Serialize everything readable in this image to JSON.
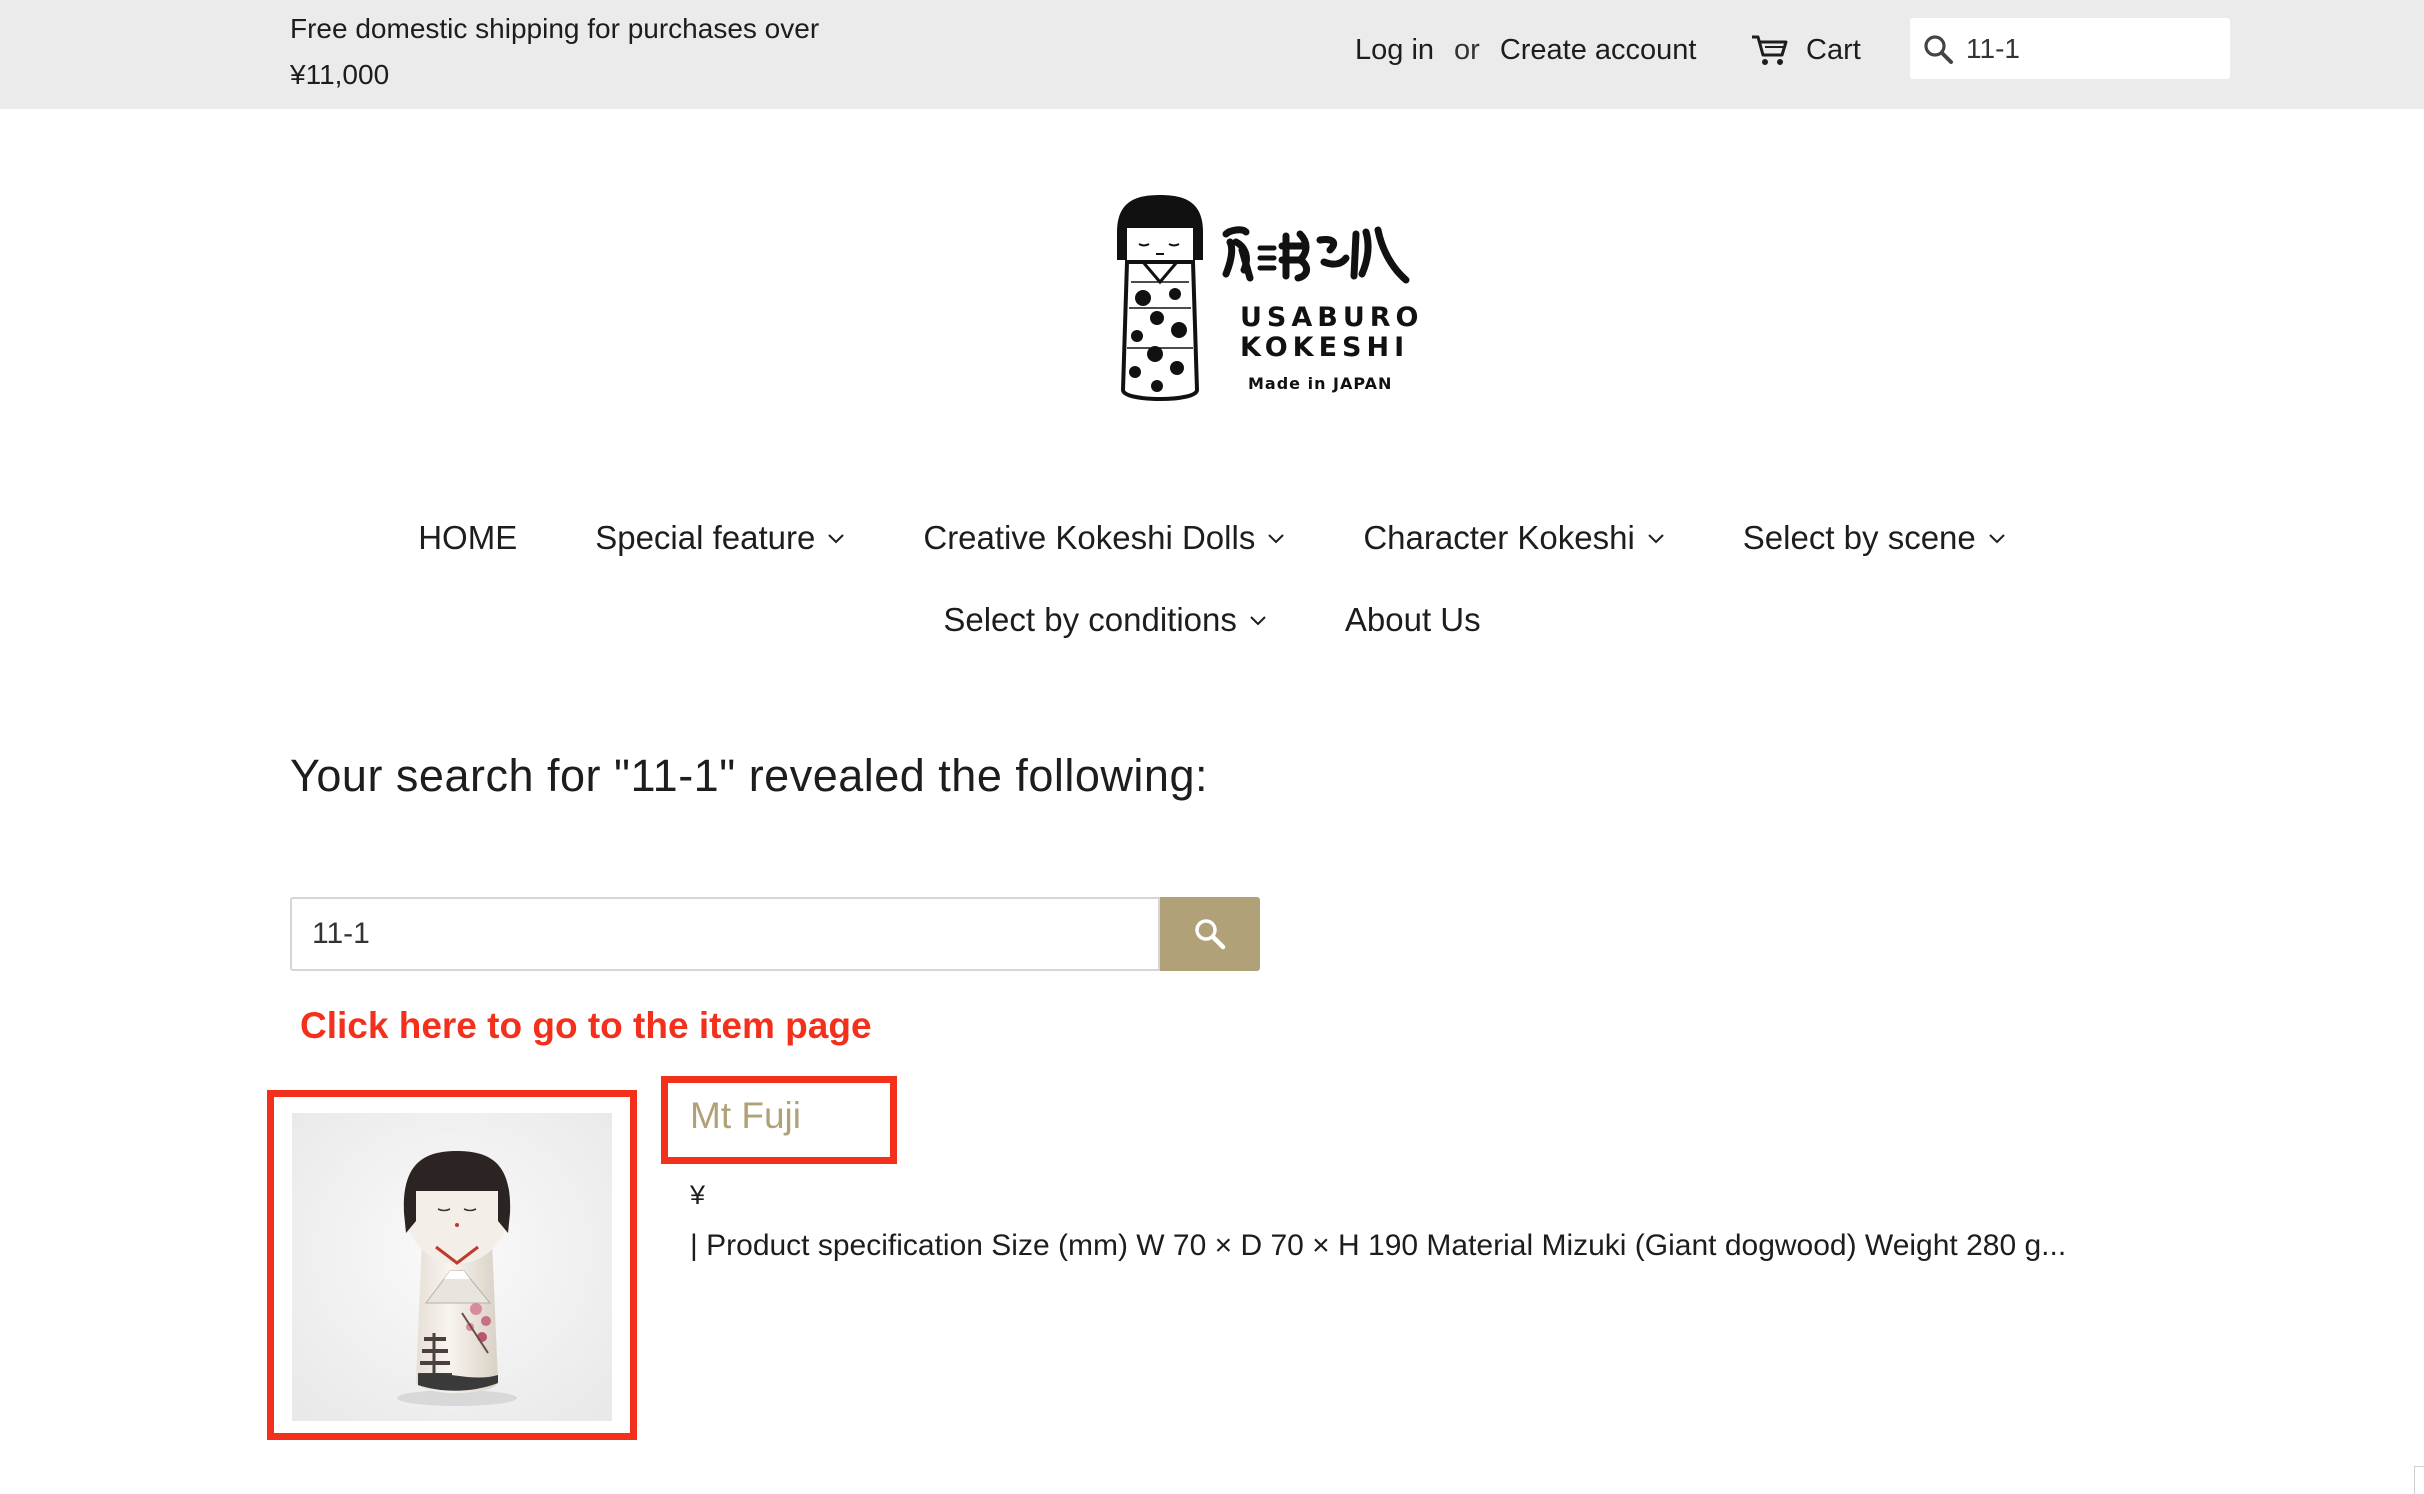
{
  "topbar": {
    "announcement_line1": "Free domestic shipping for purchases over",
    "announcement_line2": "¥11,000",
    "login_label": "Log in",
    "or_label": "or",
    "create_account_label": "Create account",
    "cart_label": "Cart",
    "search_value": "11-1"
  },
  "brand": {
    "name_line1": "USABURO",
    "name_line2": "KOKESHI",
    "tagline": "Made in JAPAN",
    "script_text": "卯三郎こけし"
  },
  "nav": {
    "row1": [
      {
        "label": "HOME",
        "has_dropdown": false
      },
      {
        "label": "Special feature",
        "has_dropdown": true
      },
      {
        "label": "Creative Kokeshi Dolls",
        "has_dropdown": true
      },
      {
        "label": "Character Kokeshi",
        "has_dropdown": true
      },
      {
        "label": "Select by scene",
        "has_dropdown": true
      }
    ],
    "row2": [
      {
        "label": "Select by conditions",
        "has_dropdown": true
      },
      {
        "label": "About Us",
        "has_dropdown": false
      }
    ]
  },
  "search_results": {
    "heading": "Your search for \"11-1\" revealed the following:",
    "search_value": "11-1"
  },
  "annotation": {
    "text": "Click here to go to the item page",
    "color": "#f2301b"
  },
  "product": {
    "title": "Mt Fuji",
    "price": "¥",
    "description": "| Product specification Size (mm) W 70 × D 70 × H 190 Material Mizuki (Giant dogwood) Weight 280 g..."
  },
  "colors": {
    "topbar_bg": "#ebebeb",
    "accent_gold": "#b1a179",
    "text": "#1c1d1d",
    "highlight_red": "#f2301b"
  },
  "icons": {
    "cart": "cart-icon",
    "search": "search-icon",
    "dropdown": "chevron-down-icon"
  }
}
